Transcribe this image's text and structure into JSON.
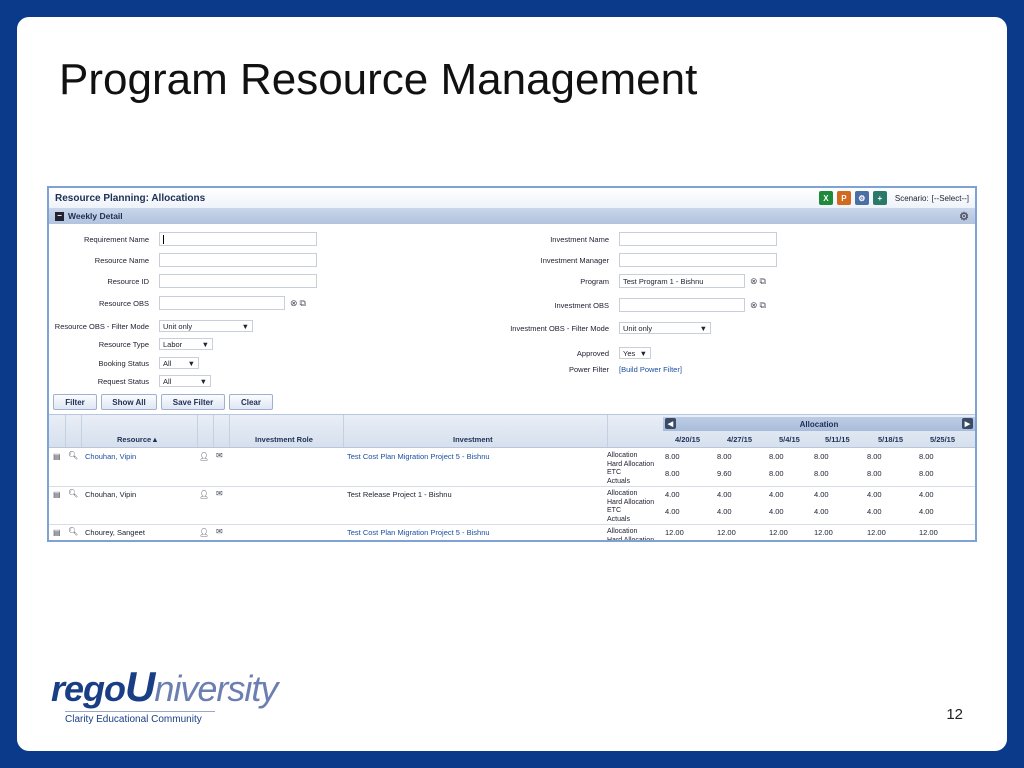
{
  "slide": {
    "title": "Program Resource Management",
    "number": "12",
    "logo": {
      "rego": "rego",
      "u": "U",
      "niversity": "niversity",
      "tagline": "Clarity Educational Community"
    }
  },
  "app": {
    "title": "Resource Planning: Allocations",
    "scenario_label": "Scenario:",
    "scenario_value": "[--Select--]",
    "icons": [
      "excel-icon",
      "powerpoint-icon",
      "configure-icon",
      "add-icon"
    ],
    "section": "Weekly Detail"
  },
  "filters": {
    "left": {
      "requirement_name": {
        "label": "Requirement Name",
        "value": ""
      },
      "resource_name": {
        "label": "Resource Name",
        "value": ""
      },
      "resource_id": {
        "label": "Resource ID",
        "value": ""
      },
      "resource_obs": {
        "label": "Resource OBS",
        "value": ""
      },
      "resource_obs_mode": {
        "label": "Resource OBS - Filter Mode",
        "value": "Unit only"
      },
      "resource_type": {
        "label": "Resource Type",
        "value": "Labor"
      },
      "booking_status": {
        "label": "Booking Status",
        "value": "All"
      },
      "request_status": {
        "label": "Request Status",
        "value": "All"
      }
    },
    "right": {
      "investment_name": {
        "label": "Investment Name",
        "value": ""
      },
      "investment_manager": {
        "label": "Investment Manager",
        "value": ""
      },
      "program": {
        "label": "Program",
        "value": "Test Program 1 - Bishnu"
      },
      "investment_obs": {
        "label": "Investment OBS",
        "value": ""
      },
      "investment_obs_mode": {
        "label": "Investment OBS - Filter Mode",
        "value": "Unit only"
      },
      "approved": {
        "label": "Approved",
        "value": "Yes"
      },
      "power_filter": {
        "label": "Power Filter",
        "link": "[Build Power Filter]"
      }
    },
    "buttons": {
      "filter": "Filter",
      "show_all": "Show All",
      "save_filter": "Save Filter",
      "clear": "Clear"
    }
  },
  "grid": {
    "allocation_label": "Allocation",
    "columns": {
      "resource": "Resource",
      "investment_role": "Investment Role",
      "investment": "Investment"
    },
    "weeks": [
      "4/20/15",
      "4/27/15",
      "5/4/15",
      "5/11/15",
      "5/18/15",
      "5/25/15"
    ],
    "metric_labels": [
      "Allocation",
      "Hard Allocation",
      "ETC",
      "Actuals"
    ],
    "rows": [
      {
        "resource": "Chouhan, Vipin",
        "investment": "Test Cost Plan Migration Project 5 - Bishnu",
        "allocation": [
          "8.00",
          "8.00",
          "8.00",
          "8.00",
          "8.00",
          "8.00"
        ],
        "etc": [
          "8.00",
          "9.60",
          "8.00",
          "8.00",
          "8.00",
          "8.00"
        ]
      },
      {
        "resource": "Chouhan, Vipin",
        "investment": "Test Release Project 1 - Bishnu",
        "allocation": [
          "4.00",
          "4.00",
          "4.00",
          "4.00",
          "4.00",
          "4.00"
        ],
        "etc": [
          "4.00",
          "4.00",
          "4.00",
          "4.00",
          "4.00",
          "4.00"
        ]
      },
      {
        "resource": "Chourey, Sangeet",
        "investment": "Test Cost Plan Migration Project 5 - Bishnu",
        "allocation": [
          "12.00",
          "12.00",
          "12.00",
          "12.00",
          "12.00",
          "12.00"
        ],
        "etc": []
      }
    ]
  }
}
